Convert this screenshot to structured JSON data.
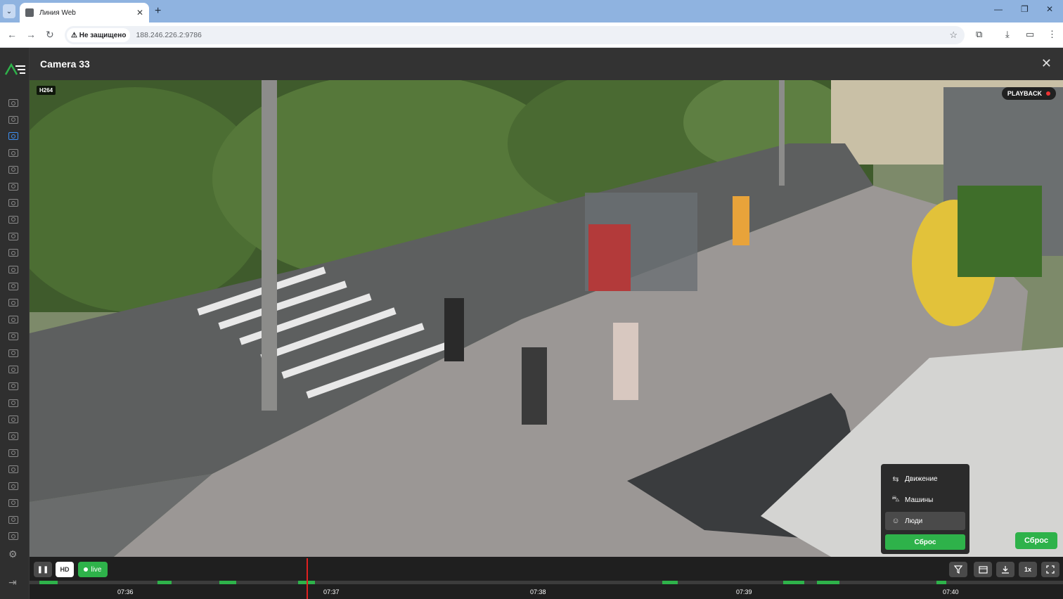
{
  "browser": {
    "tab_title": "Линия Web",
    "security_label": "Не защищено",
    "url": "188.246.226.2:9786"
  },
  "app": {
    "camera_title": "Camera 33",
    "codec_badge": "H264",
    "playback_label": "PLAYBACK"
  },
  "filter_menu": {
    "items": [
      {
        "label": "Движение",
        "icon": "motion-icon"
      },
      {
        "label": "Машины",
        "icon": "car-icon"
      },
      {
        "label": "Люди",
        "icon": "person-icon"
      }
    ],
    "reset_label": "Сброс"
  },
  "overlay_reset_label": "Сброс",
  "controls": {
    "hd_label": "HD",
    "live_label": "live",
    "speed_label": "1x"
  },
  "timeline": {
    "ticks": [
      "07:36",
      "07:37",
      "07:38",
      "07:39",
      "07:40"
    ]
  },
  "colors": {
    "accent_green": "#2eb24a",
    "cursor_red": "#e02020",
    "active_camera_blue": "#3d8ff0"
  }
}
